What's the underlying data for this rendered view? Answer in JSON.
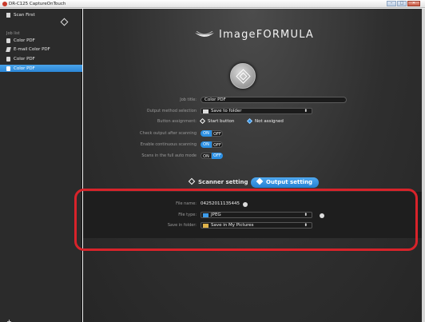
{
  "window": {
    "title": "DR-C125 CaptureOnTouch",
    "min": "–",
    "max": "□",
    "close": "✕"
  },
  "sidebar": {
    "scan_first": "Scan First",
    "job_list_label": "Job list",
    "items": [
      {
        "label": "Color PDF"
      },
      {
        "label": "E-mail Color PDF"
      },
      {
        "label": "Color PDF"
      },
      {
        "label": "Color PDF"
      }
    ],
    "add": "+"
  },
  "header": {
    "brand": "ImageFORMULA"
  },
  "form": {
    "job_title_label": "Job title:",
    "job_title_value": "Color PDF",
    "output_method_label": "Output method selection",
    "output_method_value": "Save to folder",
    "button_assignment_label": "Button assignment:",
    "start_button": "Start button",
    "not_assigned": "Not assigned",
    "check_output_label": "Check output after scanning",
    "continuous_label": "Enable continuous scanning",
    "full_auto_label": "Scans in the full auto mode",
    "on": "ON",
    "off": "OFF"
  },
  "tabs": {
    "scanner": "Scanner setting",
    "output": "Output setting"
  },
  "output": {
    "file_name_label": "File name:",
    "file_name_value": "04252011135445",
    "file_type_label": "File type:",
    "file_type_value": "JPEG",
    "save_folder_label": "Save in folder:",
    "save_folder_value": "Save in My Pictures"
  },
  "colors": {
    "accent": "#2b8fe3",
    "highlight": "#d8232a"
  }
}
